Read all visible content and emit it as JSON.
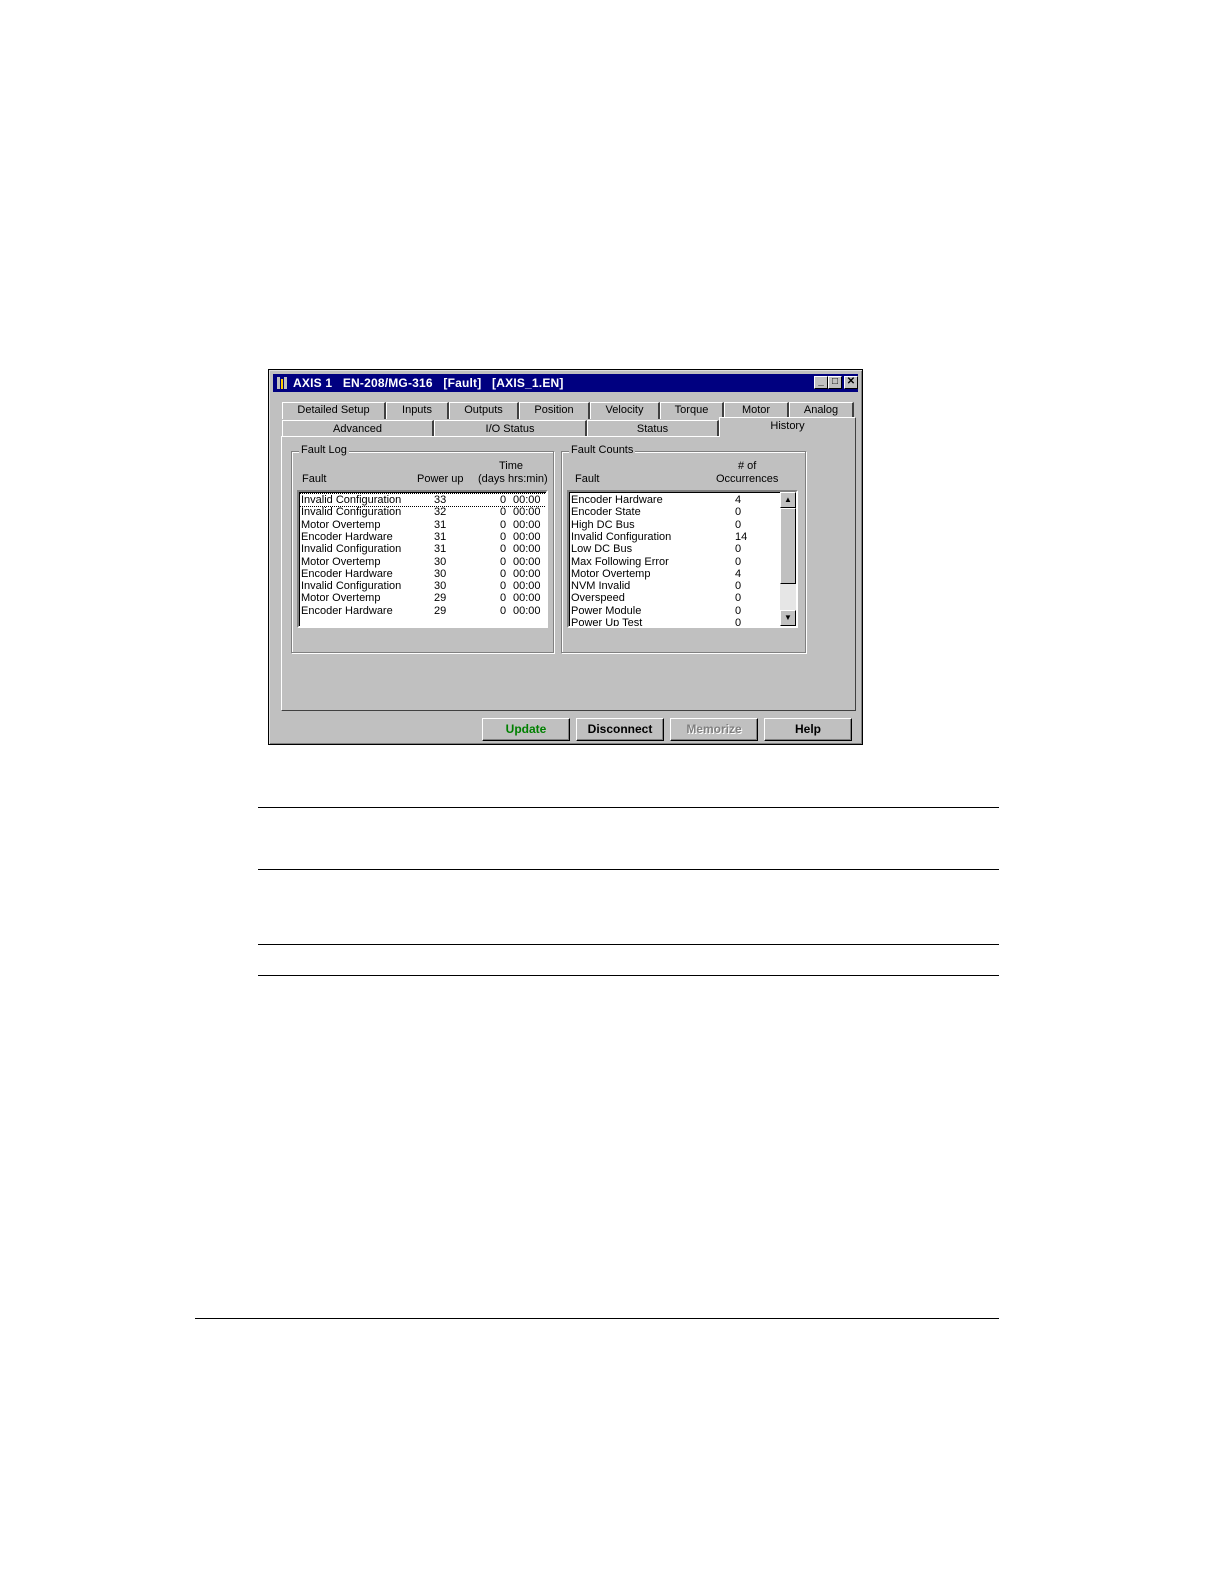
{
  "window": {
    "title": "AXIS 1   EN-208/MG-316   [Fault]   [AXIS_1.EN]",
    "min_glyph": "_",
    "max_glyph": "□",
    "close_glyph": "✕"
  },
  "tabs_row1": [
    "Detailed Setup",
    "Inputs",
    "Outputs",
    "Position",
    "Velocity",
    "Torque",
    "Motor",
    "Analog"
  ],
  "tabs_row2": [
    "Advanced",
    "I/O Status",
    "Status",
    "History"
  ],
  "active_tab": "History",
  "fault_log": {
    "group_label": "Fault Log",
    "col_fault": "Fault",
    "col_powerup": "Power up",
    "col_time_1": "Time",
    "col_time_2": "(days hrs:min)",
    "rows": [
      {
        "fault": "Invalid Configuration",
        "powerup": "33",
        "days": "0",
        "time": "00:00"
      },
      {
        "fault": "Invalid Configuration",
        "powerup": "32",
        "days": "0",
        "time": "00:00"
      },
      {
        "fault": "Motor Overtemp",
        "powerup": "31",
        "days": "0",
        "time": "00:00"
      },
      {
        "fault": "Encoder Hardware",
        "powerup": "31",
        "days": "0",
        "time": "00:00"
      },
      {
        "fault": "Invalid Configuration",
        "powerup": "31",
        "days": "0",
        "time": "00:00"
      },
      {
        "fault": "Motor Overtemp",
        "powerup": "30",
        "days": "0",
        "time": "00:00"
      },
      {
        "fault": "Encoder Hardware",
        "powerup": "30",
        "days": "0",
        "time": "00:00"
      },
      {
        "fault": "Invalid Configuration",
        "powerup": "30",
        "days": "0",
        "time": "00:00"
      },
      {
        "fault": "Motor Overtemp",
        "powerup": "29",
        "days": "0",
        "time": "00:00"
      },
      {
        "fault": "Encoder Hardware",
        "powerup": "29",
        "days": "0",
        "time": "00:00"
      }
    ]
  },
  "fault_counts": {
    "group_label": "Fault Counts",
    "col_fault": "Fault",
    "col_occ_1": "# of",
    "col_occ_2": "Occurrences",
    "rows": [
      {
        "fault": "Encoder Hardware",
        "count": "4"
      },
      {
        "fault": "Encoder State",
        "count": "0"
      },
      {
        "fault": "High DC Bus",
        "count": "0"
      },
      {
        "fault": "Invalid Configuration",
        "count": "14"
      },
      {
        "fault": "Low DC Bus",
        "count": "0"
      },
      {
        "fault": "Max Following Error",
        "count": "0"
      },
      {
        "fault": "Motor Overtemp",
        "count": "4"
      },
      {
        "fault": "NVM Invalid",
        "count": "0"
      },
      {
        "fault": "Overspeed",
        "count": "0"
      },
      {
        "fault": "Power Module",
        "count": "0"
      },
      {
        "fault": "Power Up Test",
        "count": "0"
      }
    ]
  },
  "buttons": {
    "update": "Update",
    "disconnect": "Disconnect",
    "memorize": "Memorize",
    "help": "Help"
  },
  "colors": {
    "title_bar": "#000080",
    "update_text": "#008000",
    "disabled_text": "#808080"
  }
}
